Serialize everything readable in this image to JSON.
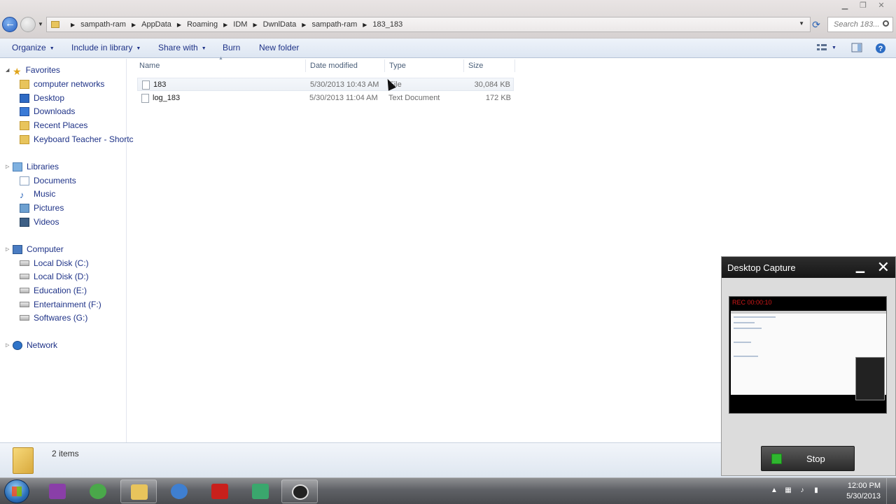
{
  "window": {
    "breadcrumb": [
      "sampath-ram",
      "AppData",
      "Roaming",
      "IDM",
      "DwnlData",
      "sampath-ram",
      "183_183"
    ],
    "search_placeholder": "Search 183..."
  },
  "toolbar": {
    "organize": "Organize",
    "include_library": "Include in library",
    "share_with": "Share with",
    "burn": "Burn",
    "new_folder": "New folder"
  },
  "sidebar": {
    "favorites": {
      "label": "Favorites",
      "items": [
        "computer networks",
        "Desktop",
        "Downloads",
        "Recent Places",
        "Keyboard Teacher - Shortc"
      ]
    },
    "libraries": {
      "label": "Libraries",
      "items": [
        "Documents",
        "Music",
        "Pictures",
        "Videos"
      ]
    },
    "computer": {
      "label": "Computer",
      "items": [
        "Local Disk (C:)",
        "Local Disk (D:)",
        "Education (E:)",
        "Entertainment (F:)",
        "Softwares (G:)"
      ]
    },
    "network": {
      "label": "Network"
    }
  },
  "columns": {
    "name": "Name",
    "date": "Date modified",
    "type": "Type",
    "size": "Size"
  },
  "files": [
    {
      "name": "183",
      "date": "5/30/2013 10:43 AM",
      "type": "File",
      "size": "30,084 KB"
    },
    {
      "name": "log_183",
      "date": "5/30/2013 11:04 AM",
      "type": "Text Document",
      "size": "172 KB"
    }
  ],
  "status": {
    "item_count": "2 items"
  },
  "capture": {
    "title": "Desktop Capture",
    "rec_label": "REC 00:00:10",
    "stop_label": "Stop"
  },
  "taskbar": {
    "clock_time": "12:00 PM",
    "clock_date": "5/30/2013"
  },
  "colors": {
    "link_text": "#1e3287",
    "toolbar_bg": "#dde6f2",
    "taskbar_bg": "#5f6166",
    "rec_red": "#d01818",
    "stop_green": "#2fb62f"
  }
}
